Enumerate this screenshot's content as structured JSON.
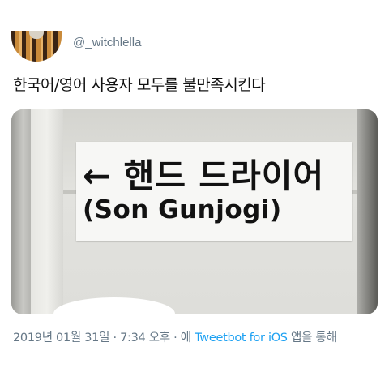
{
  "tweet": {
    "handle": "@_witchlella",
    "text": "한국어/영어 사용자 모두를 불만족시킨다",
    "photo": {
      "sign_line1": "← 핸드 드라이어",
      "sign_line2": "(Son Gunjogi)"
    },
    "meta": {
      "timestamp": "2019년 01월 31일 · 7:34 오후 · 에",
      "client": "Tweetbot for iOS",
      "suffix": "앱을 통해"
    }
  }
}
